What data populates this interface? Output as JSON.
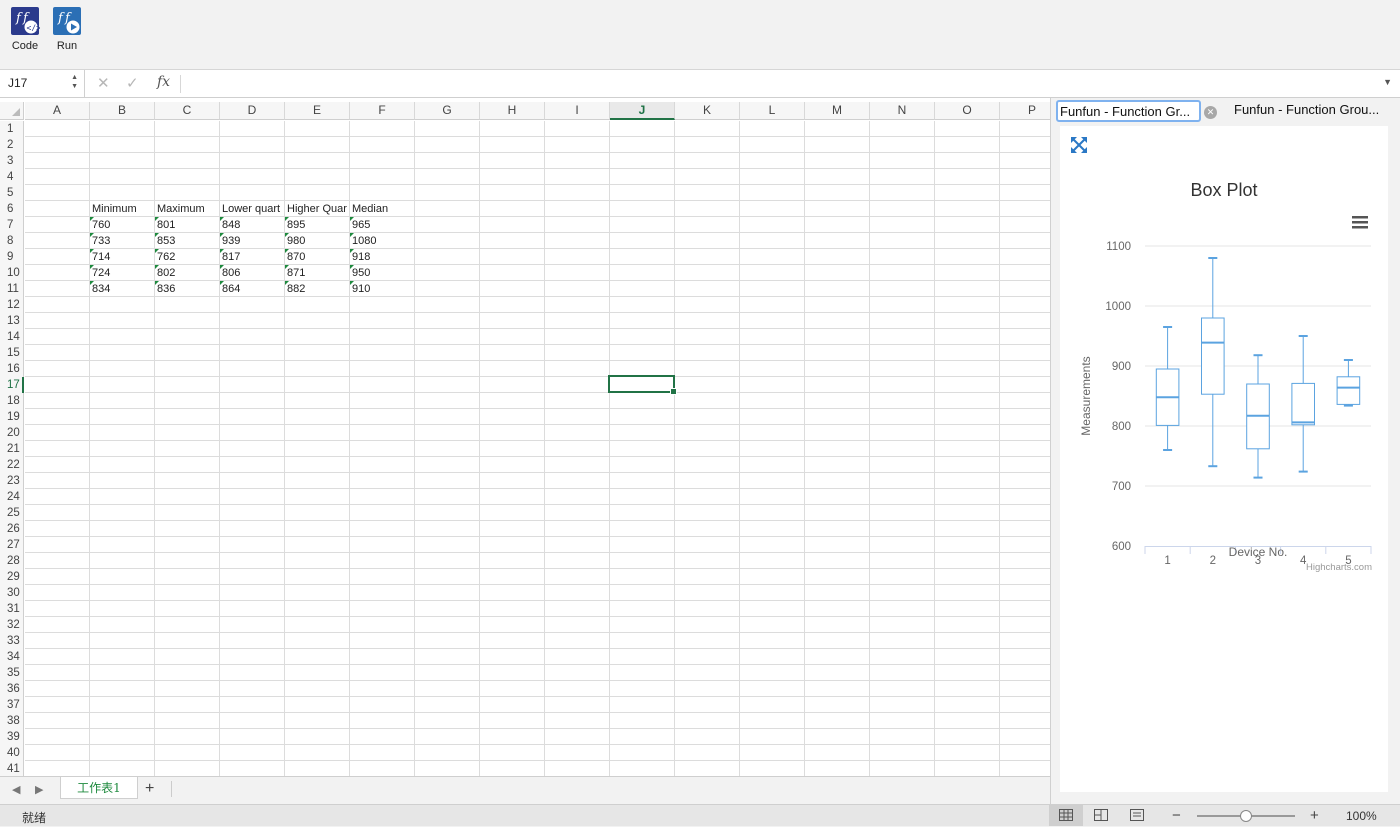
{
  "ribbon": {
    "buttons": [
      {
        "label": "Code",
        "icon": "funfun-code-icon"
      },
      {
        "label": "Run",
        "icon": "funfun-run-icon"
      }
    ]
  },
  "formula_bar": {
    "name_box": "J17",
    "cancel_icon": "cancel-icon",
    "enter_icon": "check-icon",
    "fx_label": "fx",
    "content": ""
  },
  "sheet": {
    "columns": [
      "A",
      "B",
      "C",
      "D",
      "E",
      "F",
      "G",
      "H",
      "I",
      "J",
      "K",
      "L",
      "M",
      "N",
      "O",
      "P"
    ],
    "selected_column": "J",
    "selected_row": 17,
    "row_count": 41,
    "table": {
      "headers": [
        "Minimum",
        "Maximum",
        "Lower quart",
        "Higher Quar",
        "Median"
      ],
      "rows": [
        [
          "760",
          "801",
          "848",
          "895",
          "965"
        ],
        [
          "733",
          "853",
          "939",
          "980",
          "1080"
        ],
        [
          "714",
          "762",
          "817",
          "870",
          "918"
        ],
        [
          "724",
          "802",
          "806",
          "871",
          "950"
        ],
        [
          "834",
          "836",
          "864",
          "882",
          "910"
        ]
      ]
    },
    "tab_name": "工作表1",
    "status": "就绪",
    "zoom": "100%",
    "zoom_fraction": 0.5
  },
  "pane": {
    "tabs": [
      "Funfun - Function Gr...",
      "Funfun - Function Grou..."
    ],
    "expand_icon": "expand-arrows-icon",
    "menu_icon": "hamburger-menu-icon"
  },
  "chart_data": {
    "type": "boxplot",
    "title": "Box Plot",
    "xlabel": "Device No.",
    "ylabel": "Measurements",
    "categories": [
      "1",
      "2",
      "3",
      "4",
      "5"
    ],
    "ylim": [
      600,
      1100
    ],
    "yticks": [
      "600",
      "700",
      "800",
      "900",
      "1000",
      "1100"
    ],
    "boxes": [
      {
        "low": 760,
        "q1": 801,
        "median": 848,
        "q3": 895,
        "high": 965
      },
      {
        "low": 733,
        "q1": 853,
        "median": 939,
        "q3": 980,
        "high": 1080
      },
      {
        "low": 714,
        "q1": 762,
        "median": 817,
        "q3": 870,
        "high": 918
      },
      {
        "low": 724,
        "q1": 802,
        "median": 806,
        "q3": 871,
        "high": 950
      },
      {
        "low": 834,
        "q1": 836,
        "median": 864,
        "q3": 882,
        "high": 910
      }
    ],
    "credit": "Highcharts.com",
    "color": "#5ba3e0",
    "grid": true
  }
}
